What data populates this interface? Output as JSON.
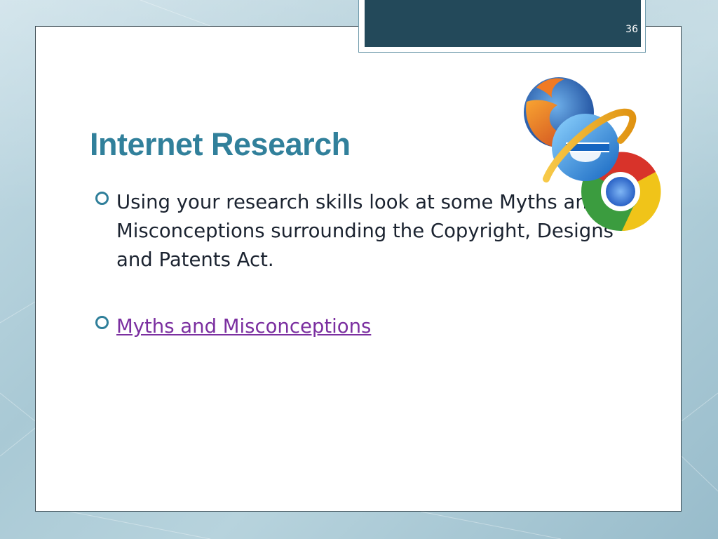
{
  "slide": {
    "number": "36",
    "title": "Internet Research",
    "bullets": [
      {
        "text": "Using your research skills look at some Myths and Misconceptions surrounding the Copyright, Designs and Patents Act."
      },
      {
        "link_text": "Myths and Misconceptions"
      }
    ]
  },
  "icons": [
    "firefox-logo-icon",
    "internet-explorer-logo-icon",
    "chrome-logo-icon",
    "bullet-ring-icon"
  ],
  "colors": {
    "title": "#31809b",
    "header_band": "#23495a",
    "bullet_ring": "#2f7f9a",
    "link": "#7b2fa0",
    "body_text": "#1b2330"
  }
}
